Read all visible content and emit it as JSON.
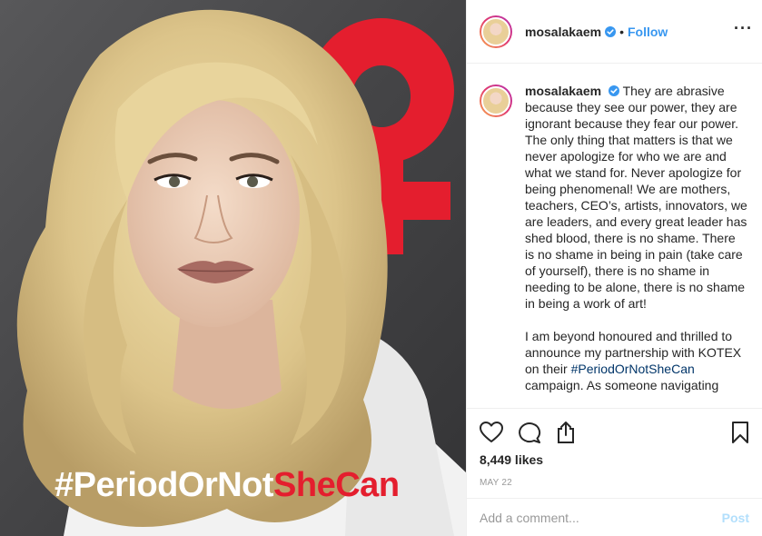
{
  "post": {
    "username": "mosalakaem",
    "follow_label": "Follow",
    "dot": "•",
    "more_label": "···",
    "image": {
      "overlay_white": "#PeriodOrNot",
      "overlay_red": "SheCan"
    },
    "caption": {
      "username": "mosalakaem",
      "para1": "They are abrasive because they see our power, they are ignorant because they fear our power. The only thing that matters is that we never apologize for who we are and what we stand for. Never apologize for being phenomenal! We are mothers, teachers, CEO’s, artists, innovators, we are leaders, and every great leader has shed blood, there is no shame. There is no shame in being in pain (take care of yourself), there is no shame in needing to be alone, there is no shame in being a work of art!",
      "para2_prefix": "I am beyond honoured and thrilled to announce my partnership with KOTEX on their ",
      "para2_tag": "#PeriodOrNotSheCan",
      "para2_cut": "campaign. As someone navigating"
    },
    "likes": "8,449 likes",
    "date": "May 22",
    "comment_placeholder": "Add a comment...",
    "post_label": "Post"
  },
  "colors": {
    "accent_blue": "#3897f0",
    "brand_red": "#e41e2e",
    "hashtag_link": "#003569"
  },
  "icons": [
    "verified-badge-icon",
    "heart-icon",
    "comment-icon",
    "share-icon",
    "bookmark-icon",
    "more-options-icon"
  ]
}
